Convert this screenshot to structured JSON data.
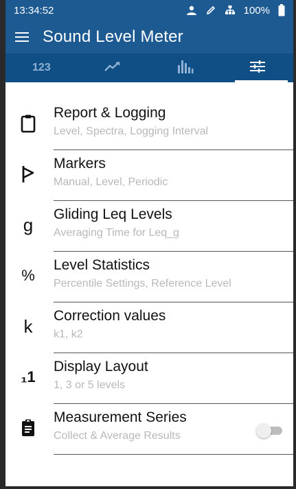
{
  "status": {
    "time": "13:34:52",
    "battery": "100%"
  },
  "appbar": {
    "title": "Sound Level Meter"
  },
  "tabs": [
    {
      "label": "123",
      "icon": "numbers-tab-icon"
    },
    {
      "label": "",
      "icon": "chart-line-icon"
    },
    {
      "label": "",
      "icon": "bar-spectrum-icon"
    },
    {
      "label": "",
      "icon": "settings-sliders-icon",
      "active": true
    }
  ],
  "menu": [
    {
      "title": "Report & Logging",
      "subtitle": "Level, Spectra, Logging Interval",
      "icon": "clipboard-icon"
    },
    {
      "title": "Markers",
      "subtitle": "Manual, Level, Periodic",
      "icon": "flag-marker-icon"
    },
    {
      "title": "Gliding Leq Levels",
      "subtitle": "Averaging Time for Leq_g",
      "icon": "g-letter-icon",
      "icon_text": "g"
    },
    {
      "title": "Level Statistics",
      "subtitle": "Percentile Settings, Reference Level",
      "icon": "percent-icon",
      "icon_text": "%"
    },
    {
      "title": "Correction values",
      "subtitle": "k1, k2",
      "icon": "k-letter-icon",
      "icon_text": "k"
    },
    {
      "title": "Display Layout",
      "subtitle": "1, 3 or 5 levels",
      "icon": "display-layout-icon",
      "icon_text": "₁1"
    },
    {
      "title": "Measurement Series",
      "subtitle": "Collect & Average Results",
      "icon": "assignment-icon",
      "toggle_on": false
    }
  ]
}
